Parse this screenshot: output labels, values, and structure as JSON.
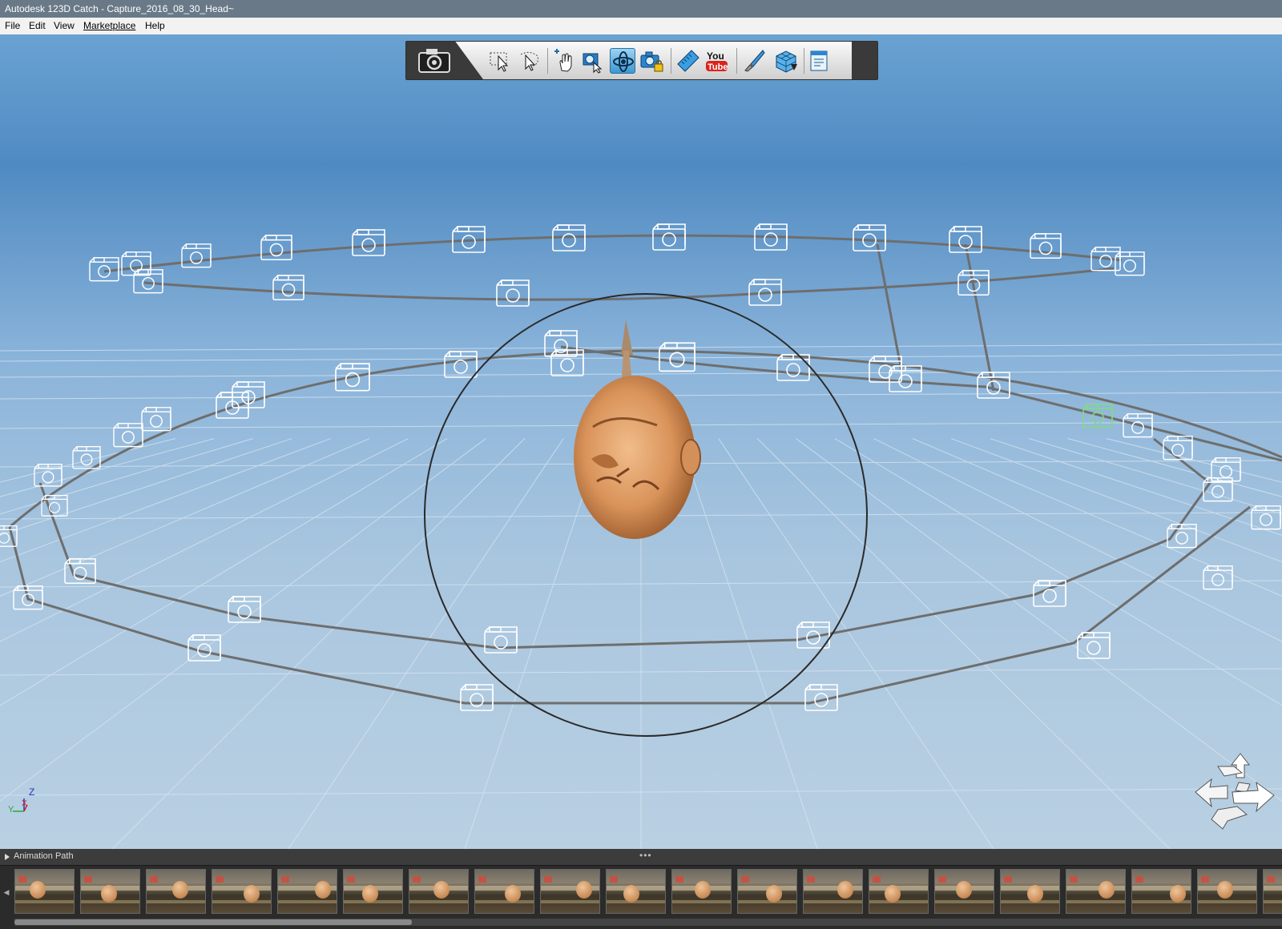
{
  "window": {
    "title": "Autodesk 123D Catch - Capture_2016_08_30_Head~"
  },
  "menu": {
    "items": [
      {
        "id": "file",
        "label": "File"
      },
      {
        "id": "edit",
        "label": "Edit"
      },
      {
        "id": "view",
        "label": "View"
      },
      {
        "id": "marketplace",
        "label": "Marketplace"
      },
      {
        "id": "help",
        "label": "Help"
      }
    ]
  },
  "toolbar": {
    "capture_icon": "camera-icon",
    "tools": [
      {
        "id": "select",
        "icon": "arrow-select-icon"
      },
      {
        "id": "lasso-select",
        "icon": "lasso-select-icon"
      },
      {
        "id": "pan",
        "icon": "pan-hand-icon"
      },
      {
        "id": "zoom-window",
        "icon": "zoom-window-icon"
      },
      {
        "id": "orbit",
        "icon": "orbit-icon",
        "active": true
      },
      {
        "id": "camera-lock",
        "icon": "camera-lock-icon"
      },
      {
        "id": "measure",
        "icon": "ruler-icon"
      },
      {
        "id": "youtube",
        "icon": "youtube-icon",
        "label": "You Tube"
      },
      {
        "id": "paint",
        "icon": "brush-icon"
      },
      {
        "id": "mesh-export",
        "icon": "mesh-cube-icon"
      },
      {
        "id": "notes",
        "icon": "notes-icon"
      }
    ]
  },
  "viewport": {
    "axis_labels": {
      "z": "Z",
      "y": "Y",
      "x": "X"
    },
    "colors": {
      "camera_wire": "#ffffff",
      "camera_selected": "#7de07a",
      "path": "#6e6e6e",
      "grid": "#d9e6f0",
      "model_skin": "#d9935a"
    }
  },
  "filmstrip": {
    "title": "Animation Path",
    "thumbnail_count": 20
  }
}
